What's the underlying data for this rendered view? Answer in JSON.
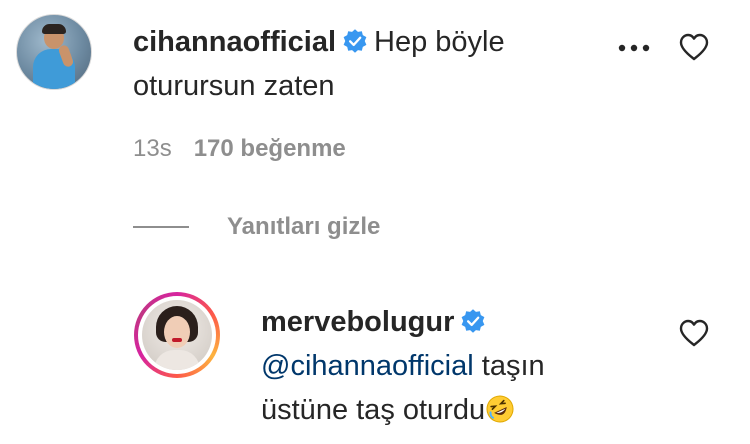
{
  "comment": {
    "username": "cihannaofficial",
    "text": "Hep böyle oturursun zaten",
    "time": "13s",
    "likes": "170 beğenme"
  },
  "replies_toggle": {
    "label": "Yanıtları gizle"
  },
  "reply": {
    "username": "mervebolugur",
    "mention": "@cihannaofficial",
    "text": "taşın üstüne taş oturdu"
  },
  "icons": {
    "verified": "verified-badge-icon",
    "more": "more-options-icon",
    "heart": "heart-outline-icon",
    "emoji": "rolling-on-floor-laughing-emoji"
  },
  "colors": {
    "verified_blue": "#3897f0",
    "mention_blue": "#00376b",
    "meta_gray": "#8e8e8e",
    "text": "#262626"
  }
}
